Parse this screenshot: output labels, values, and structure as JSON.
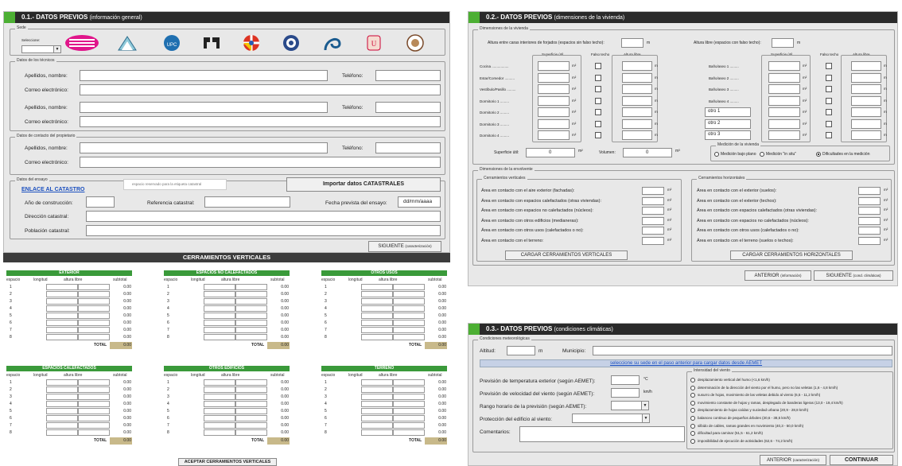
{
  "p01": {
    "title": "0.1.- DATOS PREVIOS",
    "subtitle": "(información general)",
    "sede_group": "Sede",
    "seleccione": "Seleccione:",
    "tecnicos_group": "Datos de los técnicos",
    "apellidos": "Apellidos, nombre:",
    "telefono": "Teléfono:",
    "correo": "Correo electrónico:",
    "propietario_group": "Datos de contacto del propietario",
    "ensayo_group": "Datos del ensayo",
    "enlace": "ENLACE AL CATASTRO",
    "espacio_etiqueta": "espacio reservado para la etiqueta catastral",
    "importar": "Importar datos CATASTRALES",
    "anio": "Año de construcción:",
    "referencia": "Referencia catastral:",
    "fecha": "Fecha prevista del ensayo:",
    "fecha_value": "dd/mm/aaaa",
    "direccion": "Dirección catastral:",
    "poblacion": "Población catastral:",
    "siguiente": "SIGUIENTE",
    "siguiente_sub": "(caracterización)"
  },
  "cv": {
    "title": "CERRAMIENTOS VERTICALES",
    "aceptar": "ACEPTAR CERRAMIENTOS VERTICALES",
    "tables": [
      {
        "name": "EXTERIOR"
      },
      {
        "name": "ESPACIOS NO CALEFACTADOS"
      },
      {
        "name": "OTROS USOS"
      },
      {
        "name": "ESPACIOS CALEFACTADOS"
      },
      {
        "name": "OTROS EDIFICIOS"
      },
      {
        "name": "TERRENO"
      }
    ],
    "cols": {
      "espacio": "espacio",
      "longitud": "longitud",
      "altura": "altura libre",
      "subtotal": "subtotal"
    },
    "rows": [
      "1",
      "2",
      "3",
      "4",
      "5",
      "6",
      "7",
      "8"
    ],
    "zero": "0.00",
    "total": "TOTAL"
  },
  "p02": {
    "title": "0.2.- DATOS PREVIOS",
    "subtitle": "(dimensiones de la vivienda)",
    "dim_group": "Dimensiones de la vivienda",
    "altura_caras": "Altura entre caras interiores de forjados (espacios sin falso techo):",
    "m": "m",
    "altura_libre_lbl": "Altura libre (espacios con falso techo):",
    "sup_util": "Superficie útil",
    "falso": "Falso techo",
    "alt_libre": "Altura libre",
    "m2": "m²",
    "left_rooms": [
      "Cocina .................",
      "Estar/Comedor ..........",
      "Vestíbulo/Pasillo .........",
      "Dormitorio 1 .........",
      "Dormitorio 2 .........",
      "Dormitorio 3 .........",
      "Dormitorio 4 ........."
    ],
    "right_rooms": [
      "Baño/aseo 1 .........",
      "Baño/aseo 2 .........",
      "Baño/aseo 3 .........",
      "Baño/aseo 4 ........."
    ],
    "otros": [
      "otro 1",
      "otro 2",
      "otro 3"
    ],
    "superficie_util": "Superficie útil:",
    "sup_val": "0",
    "volumen": "Volumen:",
    "vol_val": "0",
    "m3": "m³",
    "medicion_group": "Medición de la vivienda",
    "med1": "Medición bajo plano",
    "med2": "Medición \"in situ\"",
    "med3": "Dificultades en la medición",
    "env_group": "Dimensiones de la envolvente",
    "cv_group": "Cerramientos verticales",
    "ch_group": "Cerramientos horizontales",
    "cv_items": [
      "Área en contacto con el aire exterior (fachadas):",
      "Área en contacto con espacios calefactados (otras viviendas):",
      "Área en contacto con espacios no calefactados (núcleos):",
      "Área en contacto con otros edificios (medianeras):",
      "Área en contacto con otros usos (calefactados o no):",
      "Área en contacto con el terreno:"
    ],
    "ch_items": [
      "Área en contacto con el exterior (suelos):",
      "Área en contacto con el exterior (techos):",
      "Área en contacto con espacios calefactados (otras viviendas):",
      "Área en contacto con espacios no calefactados (núcleos):",
      "Área en contacto con otros usos (calefactados o no):",
      "Área en contacto con el terreno (suelos o techos):"
    ],
    "cargar_v": "CARGAR CERRAMIENTOS VERTICALES",
    "cargar_h": "CARGAR CERRAMIENTOS HORIZONTALES",
    "anterior": "ANTERIOR",
    "anterior_sub": "(información)",
    "siguiente": "SIGUIENTE",
    "siguiente_sub": "(cond. climáticas)"
  },
  "p03": {
    "title": "0.3.- DATOS PREVIOS",
    "subtitle": "(condiciones climáticas)",
    "cond_group": "Condiciones meteorológicas",
    "altitud": "Altitud:",
    "m": "m",
    "municipio": "Municipio:",
    "link": "seleccione su sede en el paso anterior para cargar datos desde AEMET",
    "temp": "Previsión de temperatura exterior (según AEMET):",
    "temp_unit": "°C",
    "vel": "Previsión de velocidad del viento (según AEMET):",
    "vel_unit": "km/h",
    "rango": "Rango horario de la previsión (según AEMET):",
    "proteccion": "Protección del edificio al viento:",
    "comentarios": "Comentarios:",
    "intensidad_group": "Intensidad del viento",
    "wind": [
      "desplazamiento vertical del humo (<1,6 km/h)",
      "determinación de la dirección del viento por el humo, pero no las veletas (1,6 - 4,8 km/h)",
      "susurro de hojas, movimiento de las veletas debido al viento (6,5 - 11,2 km/h)",
      "movimiento constante de hojas y ramas, desplegado de banderas ligeras (13,0 - 19,4 km/h)",
      "desplazamiento de hojas caídas y suciedad urbana (20,9 - 28,8 km/h)",
      "balanceo continuo de pequeños árboles (30,6 - 38,5 km/h)",
      "silbido de cables, ramas grandes en movimiento (40,3 - 50,0 km/h)",
      "dificultad para caminar (51,5 - 61,2 km/h)",
      "imposibilidad de ejecución de actividades (62,6 - 74,2 km/h)"
    ],
    "anterior": "ANTERIOR",
    "anterior_sub": "(caracterización)",
    "continuar": "CONTINUAR"
  },
  "logos": [
    "logo-1",
    "logo-2",
    "upc-logo",
    "logo-4",
    "logo-5",
    "logo-6",
    "logo-7",
    "logo-8",
    "logo-9"
  ],
  "colors": {
    "header": "#2a2a2a",
    "accent": "#4caf33",
    "table_header": "#3a9a3a",
    "total": "#c8b98a",
    "link": "#1a4fbf"
  }
}
